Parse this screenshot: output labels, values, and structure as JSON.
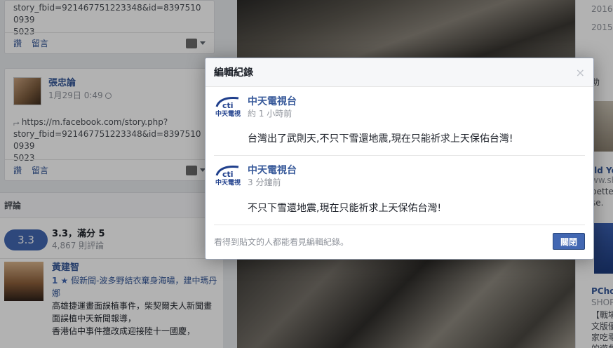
{
  "left": {
    "post1": {
      "link_line1": "story_fbid=921467751223348&id=83975100939",
      "link_line2": "5023",
      "like_label": "讚",
      "comment_label": "留言"
    },
    "post2": {
      "user_name": "張忠論",
      "time": "1月29日 0:49",
      "link_line1": "https://m.facebook.com/story.php?",
      "link_line2": "story_fbid=921467751223348&id=83975100939",
      "link_line3": "5023",
      "like_label": "讚",
      "comment_label": "留言"
    },
    "reviews": {
      "heading": "評論",
      "rating": "3.3",
      "rating_text": "3.3，滿分 5",
      "count_text": "4,867 則評論",
      "item": {
        "name": "黃建智",
        "stars": "1 ★",
        "title": "假新聞-波多野結衣棄身海嘯，建中瑪丹娜",
        "line1": "高雄捷運畫面誤植事件，柴契爾夫人新聞畫面誤植中天新聞報導，",
        "line2": "香港佔中事件擅改成迎接陸十一國慶，"
      }
    }
  },
  "right": {
    "date1": "2016",
    "date2": "2015",
    "label_suffix": "助",
    "wild": "ild Yo",
    "sh": "ww.sh",
    "better": "better",
    "se": "se.",
    "pchome": "PChom",
    "shopp": "SHOPP",
    "battle": "【戰場女",
    "line_a": "文版優惠",
    "line_b": "家吃零食",
    "line_c": "的遊戲"
  },
  "dialog": {
    "title": "編輯紀錄",
    "close_symbol": "×",
    "entries": [
      {
        "page_name": "中天電視台",
        "time": "約 1 小時前",
        "text": "台灣出了武則天,不只下雪還地震,現在只能祈求上天保佑台灣!",
        "logo_text": "中天電視"
      },
      {
        "page_name": "中天電視台",
        "time": "3 分鐘前",
        "text": "不只下雪還地震,現在只能祈求上天保佑台灣!",
        "logo_text": "中天電視"
      }
    ],
    "footer_note": "看得到貼文的人都能看見編輯紀錄。",
    "close_button": "關閉"
  },
  "colors": {
    "brand_blue": "#4267b2",
    "link_blue": "#365899",
    "cti_blue": "#1f3f8c"
  }
}
